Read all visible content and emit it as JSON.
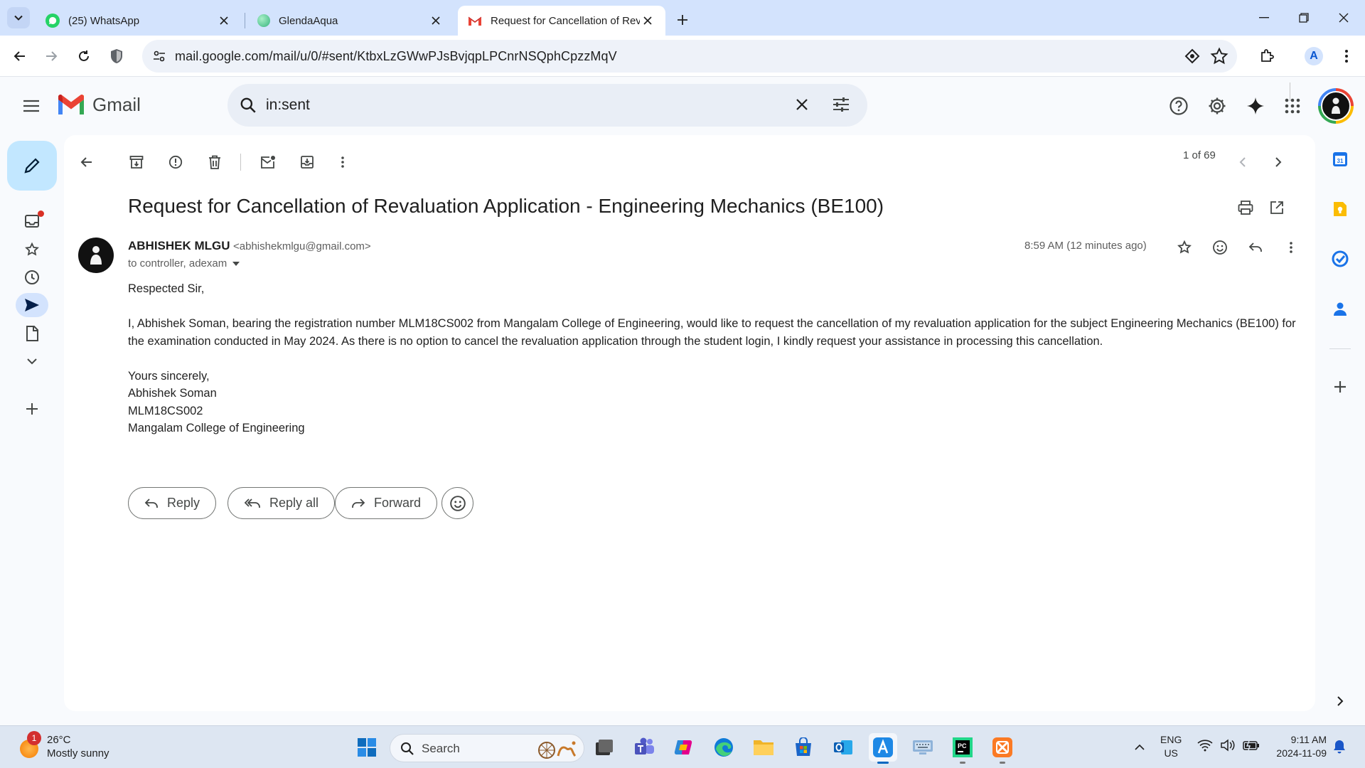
{
  "browser": {
    "tabs": [
      {
        "title": "(25) WhatsApp",
        "icon": "whatsapp-icon",
        "active": false
      },
      {
        "title": "GlendaAqua",
        "icon": "glenda-icon",
        "active": false
      },
      {
        "title": "Request for Cancellation of Rev",
        "icon": "gmail-icon",
        "active": true
      }
    ],
    "url": "mail.google.com/mail/u/0/#sent/KtbxLzGWwPJsBvjqpLPCnrNSQphCpzzMqV",
    "profile_initial": "A"
  },
  "gmail": {
    "logo_text": "Gmail",
    "search_query": "in:sent",
    "pager": "1 of 69",
    "subject": "Request for Cancellation of Revaluation Application - Engineering Mechanics (BE100)",
    "sender_name": "ABHISHEK MLGU",
    "sender_email": "<abhishekmlgu@gmail.com>",
    "recipients": "to controller, adexam",
    "time": "8:59 AM (12 minutes ago)",
    "body": {
      "greeting": "Respected Sir,",
      "para1_line1": "I, Abhishek Soman, bearing the registration number MLM18CS002 from Mangalam College of Engineering, would like to request the cancellation of my revaluation application for the subject Engineering Mechanics (BE100) for",
      "para1_line2": "the examination conducted in May 2024. As there is no option to cancel the revaluation application through the student login, I kindly request your assistance in processing this cancellation.",
      "closing": "Yours sincerely,",
      "name": "Abhishek Soman",
      "reg": "MLM18CS002",
      "college": "Mangalam College of Engineering"
    },
    "buttons": {
      "reply": "Reply",
      "reply_all": "Reply all",
      "forward": "Forward"
    }
  },
  "taskbar": {
    "weather_temp": "26°C",
    "weather_desc": "Mostly sunny",
    "weather_badge": "1",
    "search_label": "Search",
    "lang_top": "ENG",
    "lang_bottom": "US",
    "time": "9:11 AM",
    "date": "2024-11-09"
  },
  "colors": {
    "accent_blue": "#0b57d0",
    "tab_strip": "#d3e3fd",
    "compose": "#c2e7ff"
  }
}
